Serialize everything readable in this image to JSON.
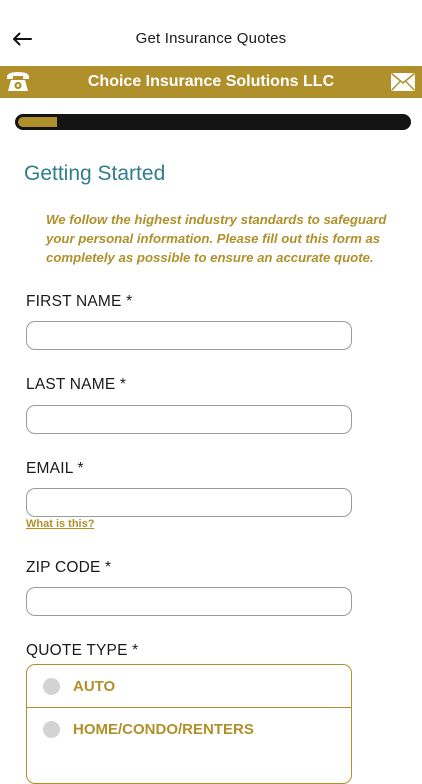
{
  "header": {
    "title": "Get Insurance Quotes",
    "back_icon": "arrow-left-icon"
  },
  "brand": {
    "name": "Choice Insurance Solutions LLC",
    "phone_icon": "phone-icon",
    "mail_icon": "envelope-icon",
    "color": "#b0902a"
  },
  "progress": {
    "fraction": 0.1
  },
  "section": {
    "title": "Getting Started",
    "intro": "We follow the highest industry standards to safeguard your personal information. Please fill out this form as completely as possible to ensure an accurate quote."
  },
  "form": {
    "first_name": {
      "label": "FIRST NAME *",
      "value": ""
    },
    "last_name": {
      "label": "LAST NAME *",
      "value": ""
    },
    "email": {
      "label": "EMAIL *",
      "value": "",
      "help": "What is this?"
    },
    "zip": {
      "label": "ZIP CODE *",
      "value": ""
    },
    "quote_type": {
      "label": "QUOTE TYPE *",
      "options": [
        "AUTO",
        "HOME/CONDO/RENTERS"
      ]
    }
  },
  "colors": {
    "accent": "#b0902a",
    "title_teal": "#2e7f8a",
    "progress_track": "#141414"
  }
}
